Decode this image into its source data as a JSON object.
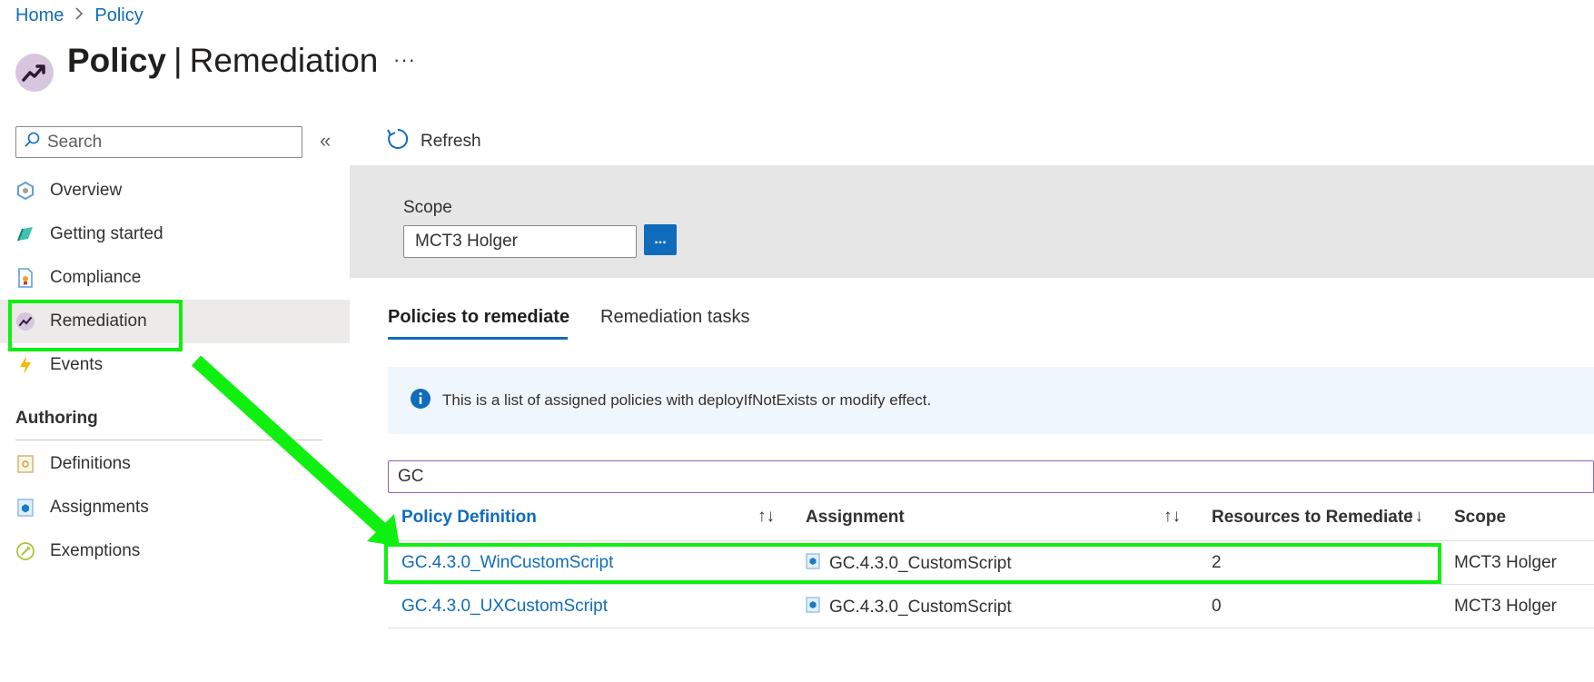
{
  "breadcrumb": {
    "home": "Home",
    "separator": ">",
    "current": "Policy"
  },
  "header": {
    "title_bold": "Policy",
    "pipe": "|",
    "title_rest": "Remediation",
    "more": "···",
    "icon": "policy-trend-icon"
  },
  "sidebar": {
    "search_placeholder": "Search",
    "collapse": "«",
    "items": [
      {
        "label": "Overview",
        "icon": "overview-icon"
      },
      {
        "label": "Getting started",
        "icon": "getting-started-icon"
      },
      {
        "label": "Compliance",
        "icon": "compliance-icon"
      },
      {
        "label": "Remediation",
        "icon": "remediation-icon",
        "selected": true
      },
      {
        "label": "Events",
        "icon": "events-icon"
      }
    ],
    "authoring_title": "Authoring",
    "authoring_items": [
      {
        "label": "Definitions",
        "icon": "definitions-icon"
      },
      {
        "label": "Assignments",
        "icon": "assignments-icon"
      },
      {
        "label": "Exemptions",
        "icon": "exemptions-icon"
      }
    ]
  },
  "toolbar": {
    "refresh_label": "Refresh"
  },
  "scope": {
    "label": "Scope",
    "value": "MCT3 Holger",
    "button_label": "..."
  },
  "tabs": [
    {
      "label": "Policies to remediate",
      "active": true
    },
    {
      "label": "Remediation tasks",
      "active": false
    }
  ],
  "info": {
    "text": "This is a list of assigned policies with deployIfNotExists or modify effect."
  },
  "filter": {
    "value": "GC"
  },
  "table": {
    "columns": [
      "Policy Definition",
      "Assignment",
      "Resources to Remediate",
      "Scope"
    ],
    "sort_glyph": "↑↓",
    "rows": [
      {
        "policy": "GC.4.3.0_WinCustomScript",
        "assignment": "GC.4.3.0_CustomScript",
        "resources": "2",
        "scope": "MCT3 Holger"
      },
      {
        "policy": "GC.4.3.0_UXCustomScript",
        "assignment": "GC.4.3.0_CustomScript",
        "resources": "0",
        "scope": "MCT3 Holger"
      }
    ]
  },
  "colors": {
    "link": "#0f6cbd",
    "highlight": "#10f010",
    "selected_bg": "#edebe9",
    "scope_panel": "#e6e6e6",
    "info_bg": "#eff6fc"
  }
}
